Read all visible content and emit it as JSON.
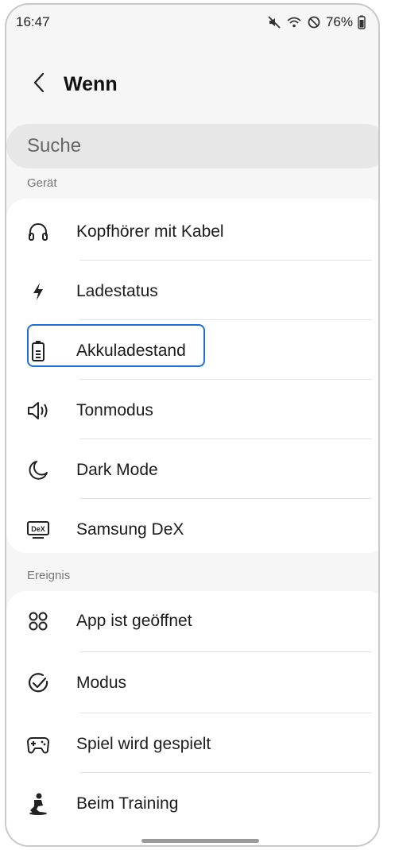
{
  "status_bar": {
    "time": "16:47",
    "battery": "76%"
  },
  "header": {
    "title": "Wenn"
  },
  "search": {
    "label": "Suche"
  },
  "sections": {
    "device": {
      "label": "Gerät",
      "items": [
        {
          "label": "Kopfhörer mit Kabel",
          "icon": "headphones-icon"
        },
        {
          "label": "Ladestatus",
          "icon": "lightning-icon"
        },
        {
          "label": "Akkuladestand",
          "icon": "battery-icon"
        },
        {
          "label": "Tonmodus",
          "icon": "speaker-icon"
        },
        {
          "label": "Dark Mode",
          "icon": "moon-icon"
        },
        {
          "label": "Samsung DeX",
          "icon": "dex-icon"
        }
      ]
    },
    "event": {
      "label": "Ereignis",
      "items": [
        {
          "label": "App ist geöffnet",
          "icon": "apps-grid-icon"
        },
        {
          "label": "Modus",
          "icon": "mode-check-icon"
        },
        {
          "label": "Spiel wird gespielt",
          "icon": "gamepad-icon"
        },
        {
          "label": "Beim Training",
          "icon": "exercise-icon"
        }
      ]
    }
  },
  "icon_text": {
    "dex": "DeX"
  },
  "colors": {
    "focus": "#1f6fd6",
    "background": "#f6f6f6",
    "card": "#ffffff"
  }
}
